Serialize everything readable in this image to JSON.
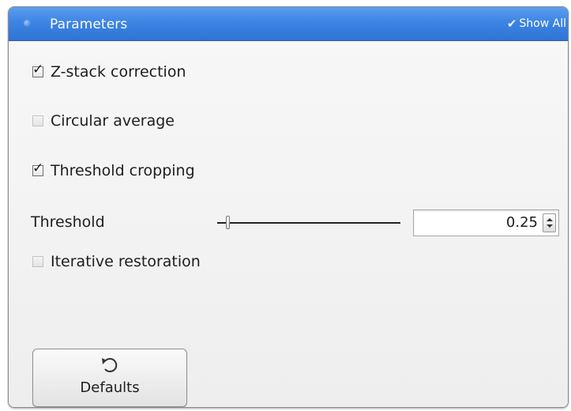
{
  "panel": {
    "title": "Parameters",
    "show_all_label": "Show All",
    "show_all_icon": "check-icon",
    "header_color": "#3d84e4"
  },
  "options": [
    {
      "label": "Z-stack correction",
      "checked": true,
      "enabled": true
    },
    {
      "label": "Circular average",
      "checked": false,
      "enabled": false
    },
    {
      "label": "Threshold cropping",
      "checked": true,
      "enabled": true
    },
    {
      "label": "Iterative restoration",
      "checked": false,
      "enabled": false
    }
  ],
  "threshold": {
    "label": "Threshold",
    "value": "0.25",
    "slider_fraction": 0.06
  },
  "defaults_button": {
    "label": "Defaults",
    "icon": "undo-icon"
  }
}
